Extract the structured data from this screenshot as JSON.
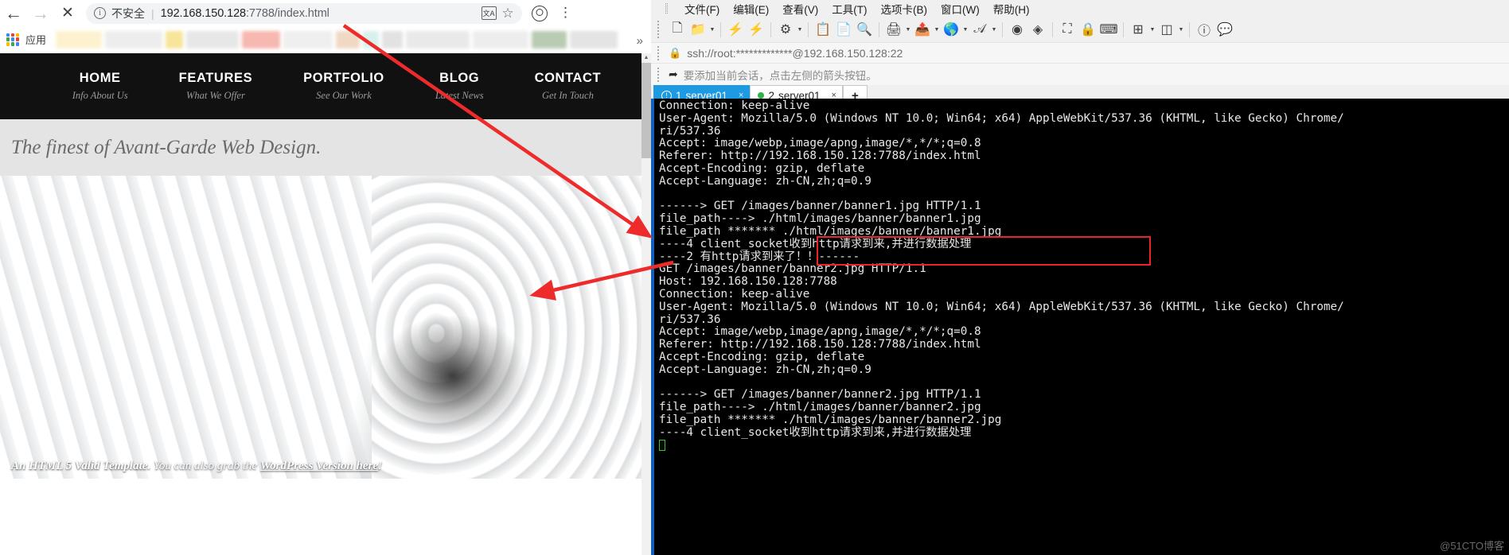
{
  "browser": {
    "toolbar": {
      "back_icon": "back-arrow-icon",
      "forward_icon": "forward-arrow-icon",
      "stop_icon": "stop-x-icon",
      "security_label": "不安全",
      "url_host": "192.168.150.128",
      "url_rest": ":7788/index.html",
      "translate_icon": "translate-icon",
      "star_icon": "bookmark-star-icon",
      "profile_icon": "profile-avatar-icon",
      "menu_icon": "kebab-menu-icon"
    },
    "bookmarks": {
      "apps_label": "应用",
      "overflow_label": "»"
    },
    "page": {
      "nav": [
        {
          "label": "HOME",
          "sub": "Info About Us"
        },
        {
          "label": "FEATURES",
          "sub": "What We Offer"
        },
        {
          "label": "PORTFOLIO",
          "sub": "See Our Work"
        },
        {
          "label": "BLOG",
          "sub": "Latest News"
        },
        {
          "label": "CONTACT",
          "sub": "Get In Touch"
        }
      ],
      "tagline": "The finest of Avant-Garde Web Design.",
      "caption_bold": "An HTML 5 Valid Template.",
      "caption_mid": " You can also grab the ",
      "caption_link": "WordPress Version here",
      "caption_end": "!"
    }
  },
  "xshell": {
    "menubar": [
      "文件(F)",
      "编辑(E)",
      "查看(V)",
      "工具(T)",
      "选项卡(B)",
      "窗口(W)",
      "帮助(H)"
    ],
    "toolbar_icons": [
      "new-session-icon",
      "open-folder-icon",
      "open-folder-dropdown",
      "connect-icon",
      "disconnect-icon",
      "session-properties-icon",
      "session-properties-dropdown",
      "copy-icon",
      "paste-icon",
      "find-icon",
      "print-icon",
      "print-dropdown",
      "transfer-file-icon",
      "transfer-file-dropdown",
      "globe-icon",
      "globe-dropdown",
      "font-icon",
      "font-dropdown",
      "log-start-icon",
      "log-stop-icon",
      "fullscreen-icon",
      "lock-icon",
      "keyboard-icon",
      "add-tab-icon",
      "add-tab-dropdown",
      "layout-icon",
      "layout-dropdown",
      "help-icon",
      "feedback-icon"
    ],
    "address": {
      "lock_icon": "lock-icon",
      "value": "ssh://root:*************@192.168.150.128:22"
    },
    "hint": {
      "icon": "add-session-arrow-icon",
      "text": "要添加当前会话，点击左侧的箭头按钮。"
    },
    "tabs": [
      {
        "num": "1",
        "label": "server01",
        "status": "warning",
        "status_glyph": "!",
        "active": true,
        "close": "×"
      },
      {
        "num": "2",
        "label": "server01",
        "status": "connected",
        "status_glyph": "",
        "active": false,
        "close": "×"
      }
    ],
    "new_tab_label": "+",
    "terminal_lines": [
      "Connection: keep-alive",
      "User-Agent: Mozilla/5.0 (Windows NT 10.0; Win64; x64) AppleWebKit/537.36 (KHTML, like Gecko) Chrome/",
      "ri/537.36",
      "Accept: image/webp,image/apng,image/*,*/*;q=0.8",
      "Referer: http://192.168.150.128:7788/index.html",
      "Accept-Encoding: gzip, deflate",
      "Accept-Language: zh-CN,zh;q=0.9",
      "",
      "------> GET /images/banner/banner1.jpg HTTP/1.1",
      "file_path----> ./html/images/banner/banner1.jpg",
      "file_path ******* ./html/images/banner/banner1.jpg",
      "----4 client_socket收到http请求到来,并进行数据处理",
      "----2 有http请求到来了！！------",
      "GET /images/banner/banner2.jpg HTTP/1.1",
      "Host: 192.168.150.128:7788",
      "Connection: keep-alive",
      "User-Agent: Mozilla/5.0 (Windows NT 10.0; Win64; x64) AppleWebKit/537.36 (KHTML, like Gecko) Chrome/",
      "ri/537.36",
      "Accept: image/webp,image/apng,image/*,*/*;q=0.8",
      "Referer: http://192.168.150.128:7788/index.html",
      "Accept-Encoding: gzip, deflate",
      "Accept-Language: zh-CN,zh;q=0.9",
      "",
      "------> GET /images/banner/banner2.jpg HTTP/1.1",
      "file_path----> ./html/images/banner/banner2.jpg",
      "file_path ******* ./html/images/banner/banner2.jpg",
      "----4 client_socket收到http请求到来,并进行数据处理"
    ],
    "watermark": "@51CTO博客"
  },
  "annotations": {
    "highlight_color": "#e8252a",
    "arrow1": "arrow from omnibox URL down-right to terminal request lines",
    "arrow2": "arrow from terminal highlight box left to browser banner image"
  }
}
